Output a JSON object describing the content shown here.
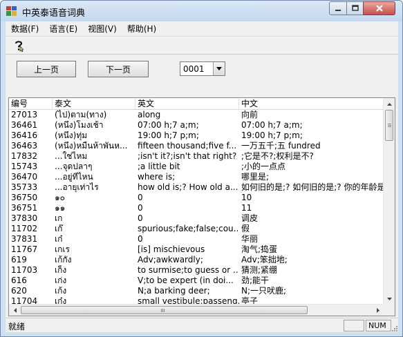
{
  "window": {
    "title": "中英泰语音词典"
  },
  "menu": {
    "items": [
      {
        "label": "数据(F)"
      },
      {
        "label": "语言(E)"
      },
      {
        "label": "视图(V)"
      },
      {
        "label": "帮助(H)"
      }
    ]
  },
  "toolbar": {
    "help_icon": "question-pointer-icon"
  },
  "nav": {
    "prev_label": "上一页",
    "next_label": "下一页",
    "record_value": "0001"
  },
  "table": {
    "columns": [
      "编号",
      "泰文",
      "英文",
      "中文"
    ],
    "rows": [
      [
        "27013",
        "(ไป)ตาม(ทาง)",
        "along",
        "向前"
      ],
      [
        "36461",
        "(หนึ่ง)โมงเช้า",
        "07:00 h;7 a;m;",
        "07:00 h;7 a;m;"
      ],
      [
        "36416",
        "(หนึ่ง)ทุ่ม",
        "19:00 h;7 p;m;",
        "19:00 h;7 p;m;"
      ],
      [
        "36463",
        "(หนึ่ง)หมื่นห้าพันห...",
        "fifteen thousand;five f...",
        "一万五千;五 fundred"
      ],
      [
        "17832",
        "...ใช่ไหม",
        ";isn't it?;isn't that right?",
        ";它是不?;权利是不?"
      ],
      [
        "15743",
        "...จุดปลาๆ",
        ";a little bit",
        ";小的一点点"
      ],
      [
        "36470",
        "...อยู่ที่ไหน",
        "where is;",
        "哪里是;"
      ],
      [
        "35733",
        "...อายุเท่าไร",
        "how old is;? How old a...",
        "如何旧的是;? 如何旧的是;? 你的年龄是"
      ],
      [
        "36750",
        "๑๐",
        "0",
        "10"
      ],
      [
        "36751",
        "๑๑",
        "0",
        "11"
      ],
      [
        "37830",
        "เก",
        "0",
        "调皮"
      ],
      [
        "11702",
        "เก๊",
        "spurious;fake;false;cou...",
        "假"
      ],
      [
        "37831",
        "เก๋",
        "0",
        "华丽"
      ],
      [
        "11767",
        "เกเร",
        "[is] mischievous",
        "淘气;捣蛋"
      ],
      [
        "619",
        "เก้กัง",
        " Adv;awkwardly;",
        "Adv;笨拙地;"
      ],
      [
        "11703",
        "เก็ง",
        "to surmise;to guess or ...",
        "猜测;紧绷"
      ],
      [
        "616",
        "เก่ง",
        " V;to be expert (in doi...",
        "劲;能干"
      ],
      [
        "620",
        "เก้ง",
        " N;a barking deer;",
        "N;一只吠鹿;"
      ],
      [
        "11704",
        "เก๋ง",
        "small vestibule;passeng...",
        "亭子"
      ]
    ]
  },
  "status": {
    "text": "就绪",
    "pane1": "",
    "pane2": "NUM"
  },
  "colors": {
    "title_bg": "#c4d8ee",
    "close_button": "#c75050",
    "face": "#f0f0f0"
  }
}
